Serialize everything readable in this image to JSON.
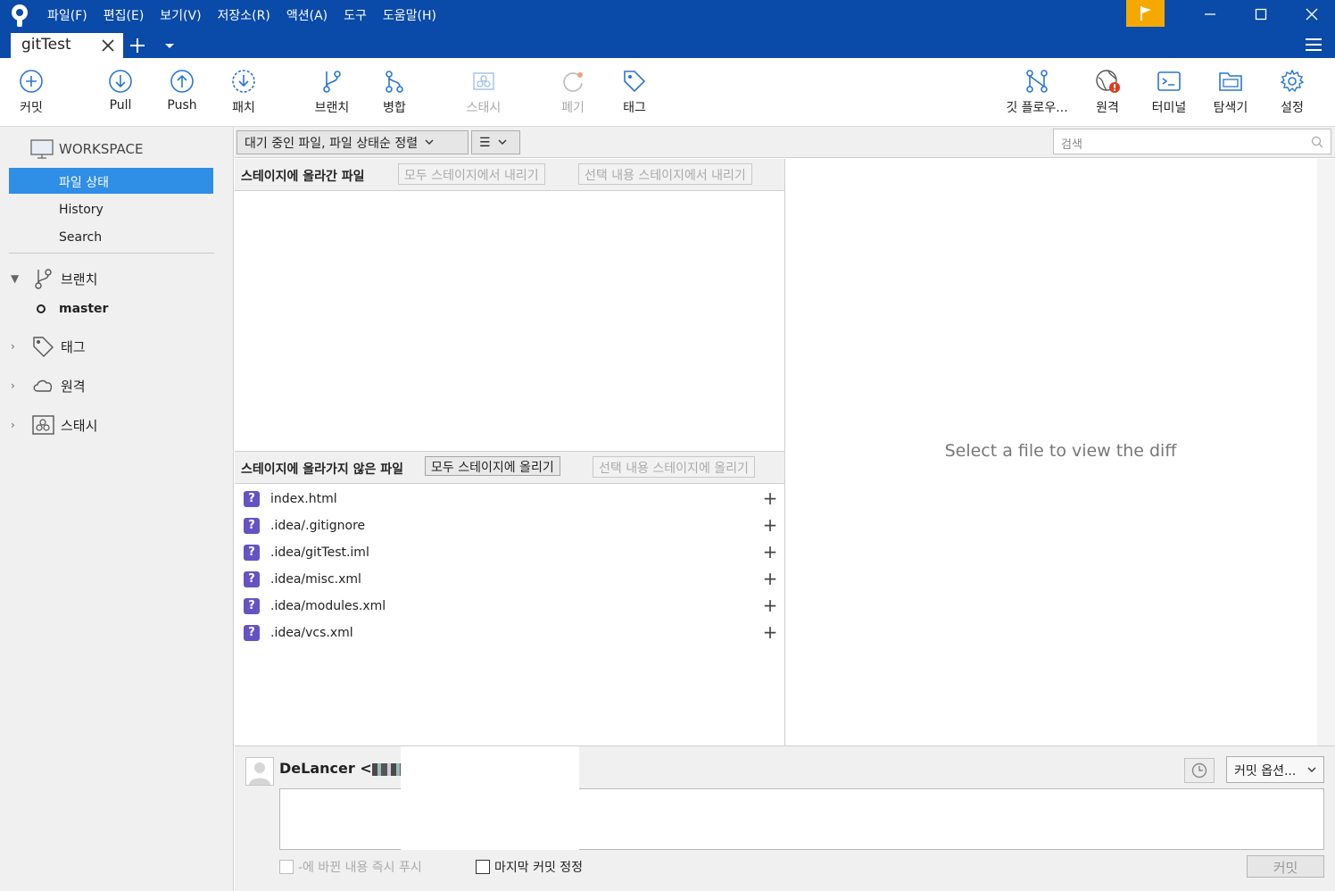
{
  "menu": {
    "items": [
      "파일(F)",
      "편집(E)",
      "보기(V)",
      "저장소(R)",
      "액션(A)",
      "도구",
      "도움말(H)"
    ]
  },
  "tab": {
    "title": "gitTest"
  },
  "toolbar": {
    "commit": "커밋",
    "pull": "Pull",
    "push": "Push",
    "patch": "패치",
    "branch": "브랜치",
    "merge": "병합",
    "stash": "스태시",
    "discard": "폐기",
    "tag": "태그",
    "gitflow": "깃 플로우...",
    "remote": "원격",
    "terminal": "터미널",
    "explorer": "탐색기",
    "settings": "설정"
  },
  "sidebar": {
    "workspace": "WORKSPACE",
    "items": [
      "파일 상태",
      "History",
      "Search"
    ],
    "branches_label": "브랜치",
    "current_branch": "master",
    "tags_label": "태그",
    "remotes_label": "원격",
    "stashes_label": "스태시"
  },
  "filter": {
    "pending_sort": "대기 중인 파일, 파일 상태순 정렬",
    "view_mode": "☰",
    "search_placeholder": "검색"
  },
  "staged": {
    "title": "스테이지에 올라간 파일",
    "unstage_all": "모두 스테이지에서 내리기",
    "unstage_selected": "선택 내용 스테이지에서 내리기"
  },
  "unstaged": {
    "title": "스테이지에 올라가지 않은 파일",
    "stage_all": "모두 스테이지에 올리기",
    "stage_selected": "선택 내용 스테이지에 올리기",
    "files": [
      "index.html",
      ".idea/.gitignore",
      ".idea/gitTest.iml",
      ".idea/misc.xml",
      ".idea/modules.xml",
      ".idea/vcs.xml"
    ]
  },
  "diff": {
    "placeholder": "Select a file to view the diff"
  },
  "commit": {
    "author": "DeLancer <",
    "options": "커밋 옵션...",
    "push_immediately": "-에 바뀐 내용 즉시 푸시",
    "amend_last": "마지막 커밋 정정",
    "commit_button": "커밋"
  },
  "colors": {
    "titlebar": "#0a4aa8",
    "accent": "#2f8ee5",
    "flag": "#f5a900",
    "untracked": "#6553c4"
  }
}
